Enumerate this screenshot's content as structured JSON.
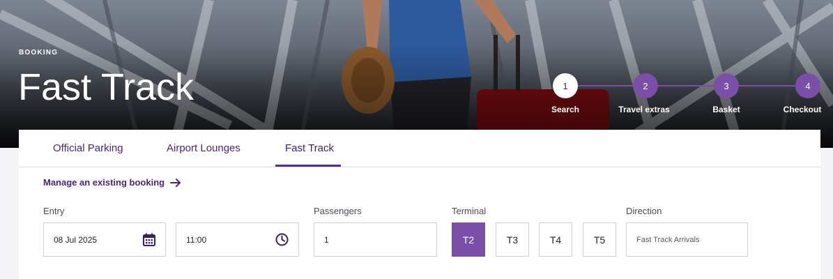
{
  "hero": {
    "eyebrow": "BOOKING",
    "title": "Fast Track"
  },
  "stepper": {
    "steps": [
      {
        "number": "1",
        "label": "Search",
        "active": true
      },
      {
        "number": "2",
        "label": "Travel extras",
        "active": false
      },
      {
        "number": "3",
        "label": "Basket",
        "active": false
      },
      {
        "number": "4",
        "label": "Checkout",
        "active": false
      }
    ]
  },
  "tabs": [
    {
      "label": "Official Parking"
    },
    {
      "label": "Airport Lounges"
    },
    {
      "label": "Fast Track",
      "selected": true
    }
  ],
  "manage_link": "Manage an existing booking",
  "form": {
    "entry_label": "Entry",
    "entry_date": "08 Jul 2025",
    "entry_time": "11:00",
    "passengers_label": "Passengers",
    "passengers_value": "1",
    "terminal_label": "Terminal",
    "terminals": [
      "T2",
      "T3",
      "T4",
      "T5"
    ],
    "selected_terminal": "T2",
    "direction_label": "Direction",
    "direction_value": "Fast Track Arrivals"
  },
  "icons": {
    "calendar": "calendar-icon",
    "clock": "clock-icon",
    "arrow": "arrow-right-icon"
  },
  "colors": {
    "brand_purple": "#7b4fa8",
    "text_purple": "#4a2577"
  }
}
